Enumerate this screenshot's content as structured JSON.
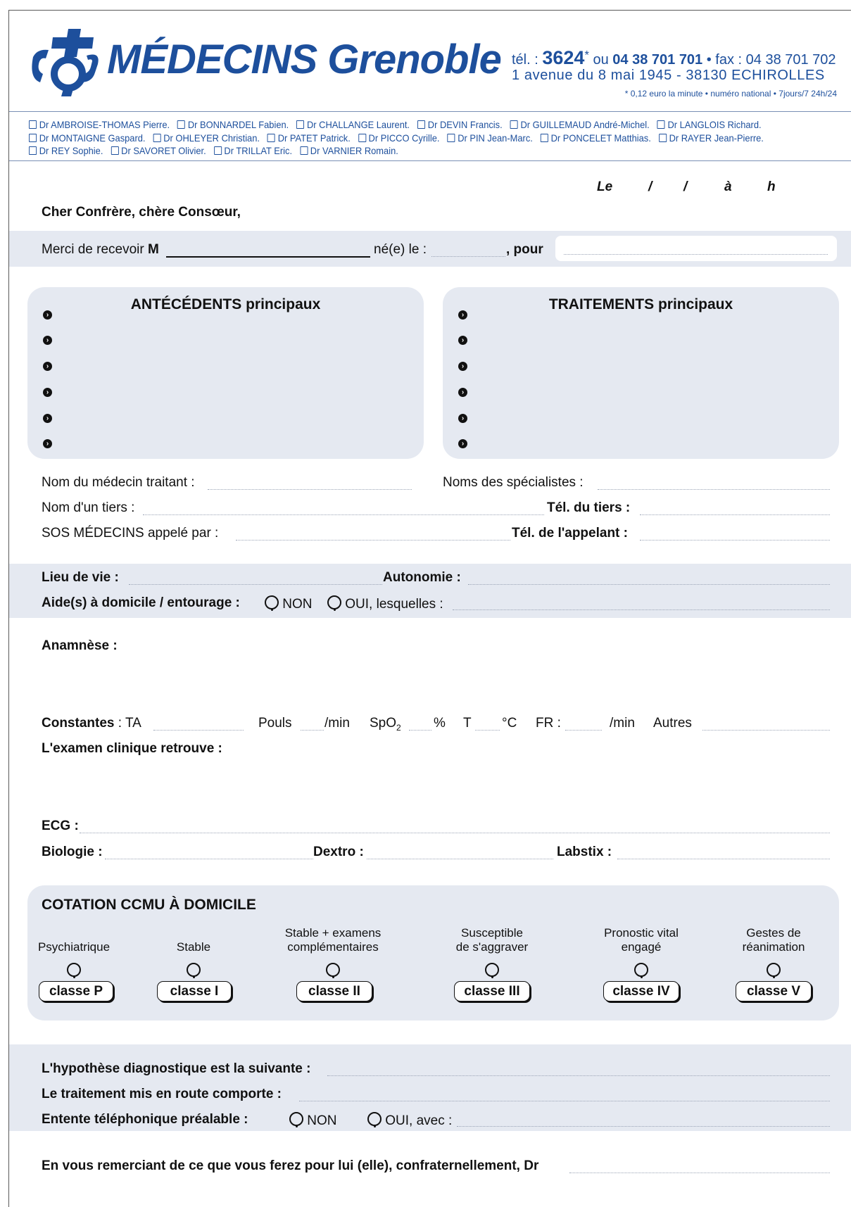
{
  "header": {
    "brand": "MÉDECINS Grenoble",
    "tel_label": "tél. : ",
    "tel_short": "3624",
    "tel_star": "*",
    "tel_or": " ou ",
    "tel_long": "04 38 701 701",
    "fax": " • fax : 04 38 701 702",
    "address": "1 avenue du 8 mai 1945 - 38130 ECHIROLLES",
    "note": "* 0,12 euro la minute • numéro national • 7jours/7 24h/24"
  },
  "doctors": [
    [
      "Dr AMBROISE-THOMAS Pierre.",
      "Dr BONNARDEL Fabien.",
      "Dr CHALLANGE Laurent.",
      "Dr DEVIN Francis.",
      "Dr GUILLEMAUD André-Michel.",
      "Dr LANGLOIS Richard."
    ],
    [
      "Dr MONTAIGNE Gaspard.",
      "Dr OHLEYER Christian.",
      "Dr PATET Patrick.",
      "Dr PICCO Cyrille.",
      "Dr PIN Jean-Marc.",
      "Dr PONCELET Matthias.",
      "Dr RAYER Jean-Pierre."
    ],
    [
      "Dr REY Sophie.",
      "Dr SAVORET Olivier.",
      "Dr TRILLAT Eric.",
      "Dr VARNIER Romain."
    ]
  ],
  "date_line": {
    "le": "Le",
    "slash": "/",
    "a": "à",
    "h": "h"
  },
  "greeting": "Cher Confrère, chère Consœur,",
  "patient": {
    "prefix": "Merci de recevoir ",
    "m": "M",
    "born": "né(e) le :",
    "pour": ", pour"
  },
  "panels": {
    "antecedents": "ANTÉCÉDENTS principaux",
    "traitements": "TRAITEMENTS principaux"
  },
  "contacts": {
    "medecin_traitant": "Nom du médecin traitant :",
    "specialistes": "Noms des spécialistes :",
    "tiers": "Nom d'un tiers :",
    "tel_tiers": "Tél. du tiers :",
    "appele_par": "SOS MÉDECINS appelé par :",
    "tel_appelant": "Tél. de l'appelant :"
  },
  "living": {
    "lieu": "Lieu de vie :",
    "autonomie": "Autonomie :",
    "aide": "Aide(s) à domicile / entourage :",
    "non": "NON",
    "oui": "OUI, lesquelles :"
  },
  "anamnese": "Anamnèse :",
  "constantes": {
    "label": "Constantes",
    "ta": " : TA",
    "pouls": "Pouls",
    "min1": "/min",
    "spo2": "SpO",
    "sub2": "2",
    "pct": "%",
    "t": "T",
    "deg": "°C",
    "fr": "FR :",
    "min2": "/min",
    "autres": "Autres"
  },
  "examen": "L'examen clinique retrouve :",
  "ecg": "ECG :",
  "biologie": "Biologie :",
  "dextro": "Dextro :",
  "labstix": "Labstix :",
  "ccmu": {
    "title": "COTATION CCMU À DOMICILE",
    "classes": [
      {
        "l1": "",
        "l2": "Psychiatrique",
        "btn": "classe P"
      },
      {
        "l1": "",
        "l2": "Stable",
        "btn": "classe I"
      },
      {
        "l1": "Stable + examens",
        "l2": "complémentaires",
        "btn": "classe II"
      },
      {
        "l1": "Susceptible",
        "l2": "de s'aggraver",
        "btn": "classe III"
      },
      {
        "l1": "Pronostic vital",
        "l2": "engagé",
        "btn": "classe IV"
      },
      {
        "l1": "Gestes de",
        "l2": "réanimation",
        "btn": "classe V"
      }
    ]
  },
  "diagnostic": "L'hypothèse diagnostique est la suivante :",
  "traitement": "Le traitement mis en route comporte :",
  "entente": {
    "label": "Entente téléphonique préalable :",
    "non": "NON",
    "oui": "OUI, avec :"
  },
  "closing": "En vous remerciant de ce que vous ferez pour lui (elle), confraternellement, Dr"
}
